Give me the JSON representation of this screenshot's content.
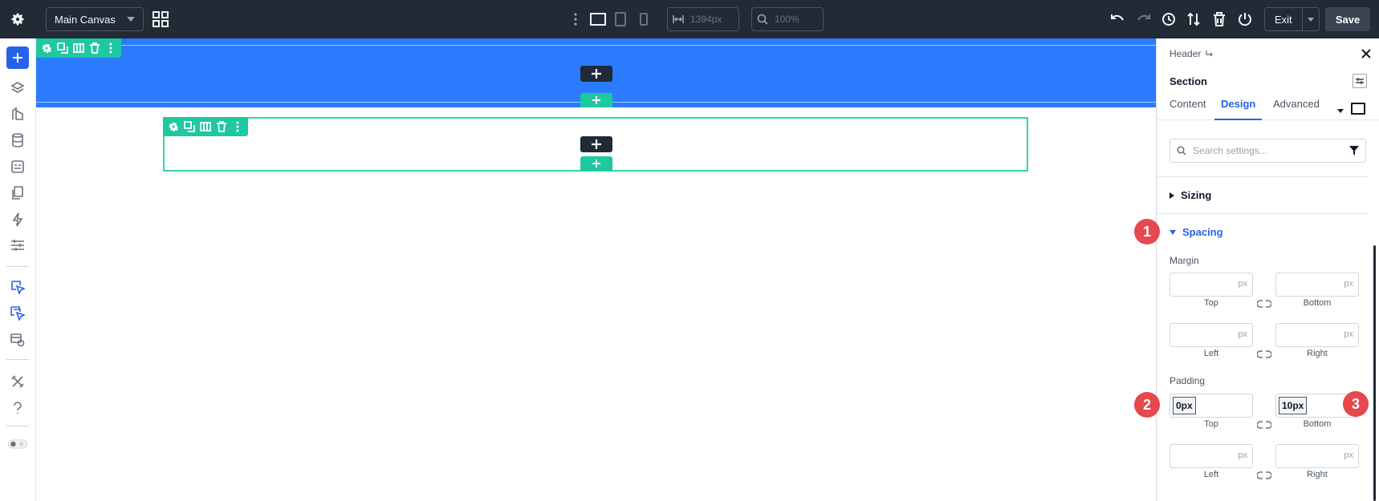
{
  "topbar": {
    "canvas_name": "Main Canvas",
    "width_value": "1394px",
    "zoom_value": "100%",
    "exit_label": "Exit",
    "save_label": "Save"
  },
  "panel": {
    "breadcrumb": "Header",
    "element_title": "Section",
    "tabs": [
      {
        "label": "Content",
        "active": false
      },
      {
        "label": "Design",
        "active": true
      },
      {
        "label": "Advanced",
        "active": false
      }
    ],
    "search_placeholder": "Search settings...",
    "groups": {
      "sizing": "Sizing",
      "spacing": "Spacing"
    },
    "margin": {
      "label": "Margin",
      "unit": "px",
      "top": "Top",
      "bottom": "Bottom",
      "left": "Left",
      "right": "Right"
    },
    "padding": {
      "label": "Padding",
      "unit": "px",
      "top_value": "0px",
      "bottom_value": "10px",
      "top": "Top",
      "bottom": "Bottom",
      "left": "Left",
      "right": "Right"
    }
  },
  "badges": [
    "1",
    "2",
    "3"
  ],
  "colors": {
    "topbar": "#222a36",
    "accent_blue": "#2563eb",
    "header_section": "#2b7bff",
    "builder_green": "#1ec8a0",
    "badge_red": "#e5484d"
  }
}
